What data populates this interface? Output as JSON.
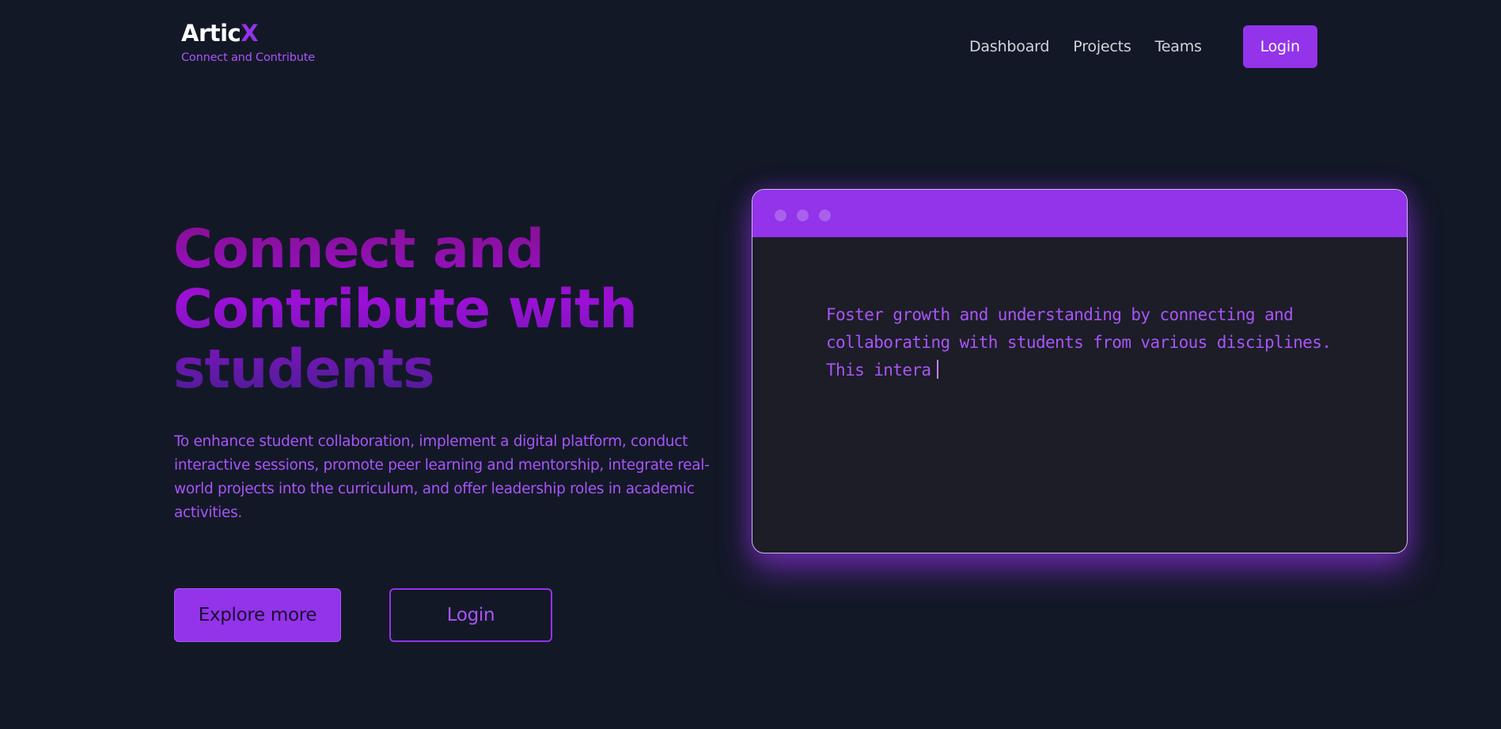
{
  "brand": {
    "name_main": "Artic",
    "name_accent": "X",
    "tagline": "Connect and Contribute"
  },
  "nav": {
    "links": [
      "Dashboard",
      "Projects",
      "Teams"
    ],
    "login_label": "Login"
  },
  "hero": {
    "title": "Connect and Contribute with students",
    "description": "To enhance student collaboration, implement a digital platform, conduct interactive sessions, promote peer learning and mentorship, integrate real-world projects into the curriculum, and offer leadership roles in academic activities.",
    "explore_label": "Explore more",
    "login_label": "Login"
  },
  "code_window": {
    "typed_text": "Foster growth and understanding by connecting and collaborating with students from various disciplines. This intera"
  },
  "colors": {
    "background": "#131827",
    "accent": "#9333ea",
    "accent_light": "#a855f7",
    "window_bg": "#1c1d27"
  }
}
